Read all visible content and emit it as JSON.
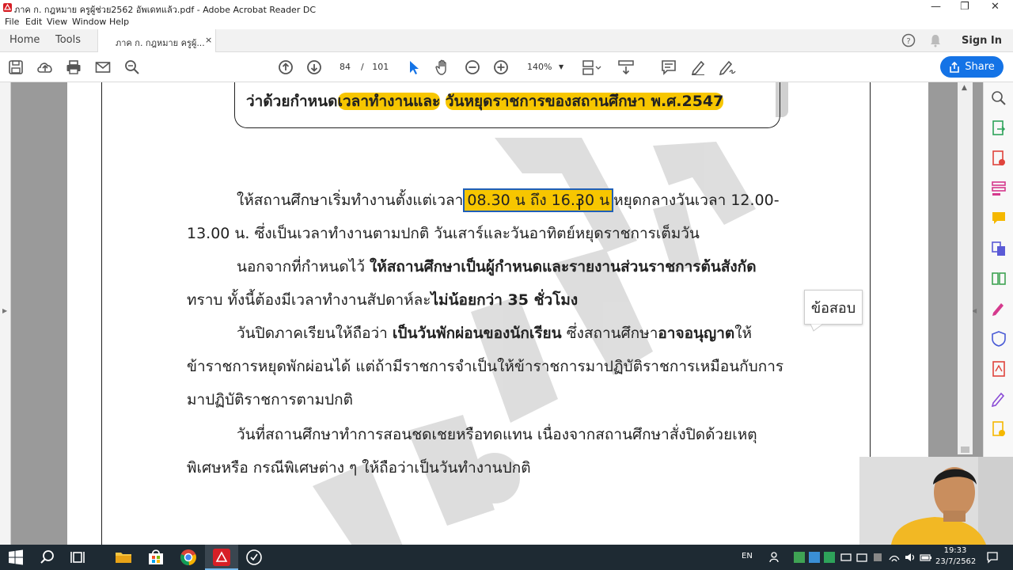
{
  "window": {
    "title": "ภาค ก. กฎหมาย ครูผู้ช่วย2562 อัพเดทแล้ว.pdf - Adobe Acrobat Reader DC",
    "minimize": "—",
    "restore": "❐",
    "close": "✕"
  },
  "menu": [
    "File",
    "Edit",
    "View",
    "Window",
    "Help"
  ],
  "tabs": {
    "home": "Home",
    "tools": "Tools",
    "document": "ภาค ก. กฎหมาย ครูผู้...",
    "close": "×",
    "sign_in": "Sign In"
  },
  "toolbar": {
    "page_current": "84",
    "page_sep": "/",
    "page_total": "101",
    "zoom": "140%",
    "share_label": "Share"
  },
  "document": {
    "heading_prefix": "ว่าด้วยกำหนด",
    "heading_hl1": "เวลาทำงานและ",
    "heading_hl2": "วันหยุดราชการของสถานศึกษา พ.ศ.2547",
    "p1_a": "ให้สถานศึกษาเริ่มทำงานตั้งแต่เวลา",
    "p1_time": "08.30 น ถึง 16.30 น",
    "p1_b": "หยุดกลางวันเวลา 12.00-",
    "p1_c": "13.00 น. ซึ่งเป็นเวลาทำงานตามปกติ วันเสาร์และวันอาทิตย์หยุดราชการเต็มวัน",
    "p2_a": "นอกจากที่กำหนดไว้",
    "p2_b": "ให้สถานศึกษาเป็นผู้กำหนดและรายงานส่วนราชการต้นสังกัด",
    "p2_c": "ทราบ ทั้งนี้ต้องมีเวลาทำงานสัปดาห์ละ",
    "p2_d": "ไม่น้อยกว่า 35 ชั่วโมง",
    "p3_a": "วันปิดภาคเรียนให้ถือว่า",
    "p3_b": "เป็นวันพักผ่อนของนักเรียน",
    "p3_c": "ซึ่งสถานศึกษา",
    "p3_d": "อาจอนุญาต",
    "p3_e": "ให้",
    "p3_f": "ข้าราชการหยุดพักผ่อนได้ แต่ถ้ามีราชการจำเป็นให้ข้าราชการมาปฏิบัติราชการเหมือนกับการ",
    "p3_g": "มาปฏิบัติราชการตามปกติ",
    "p4_a": "วันที่สถานศึกษาทำการสอนชดเชยหรือทดแทน เนื่องจากสถานศึกษาสั่งปิดด้วยเหตุ",
    "p4_b": "พิเศษหรือ กรณีพิเศษต่าง ๆ ให้ถือว่าเป็นวันทำงานปกติ",
    "comment_bubble": "ข้อสอบ"
  },
  "taskbar": {
    "lang": "EN",
    "time": "19:33",
    "date": "23/7/2562"
  },
  "colors": {
    "highlight": "#f7c600",
    "accent": "#1473e6",
    "taskbar": "#1e2a33"
  }
}
